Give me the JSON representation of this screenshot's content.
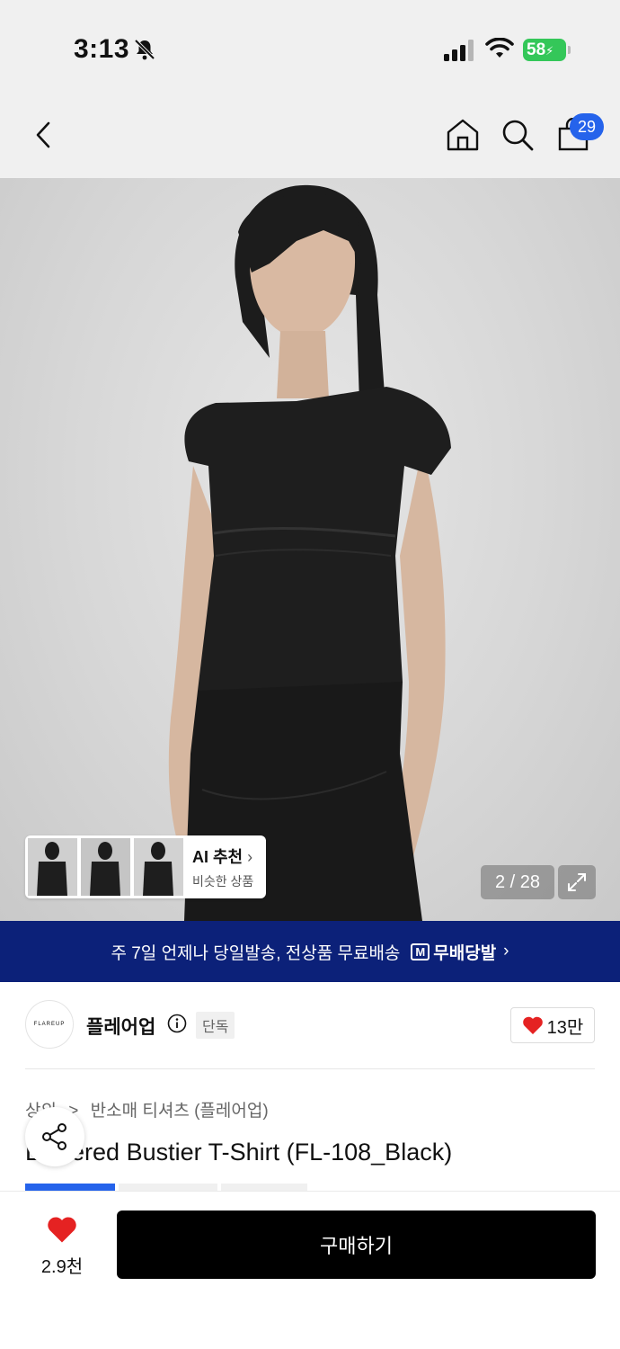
{
  "status": {
    "time": "3:13",
    "battery": "58"
  },
  "nav": {
    "cart_count": "29"
  },
  "hero": {
    "ai_title": "AI 추천",
    "ai_subtitle": "비슷한 상품",
    "counter": "2 / 28"
  },
  "promo": {
    "text": "주 7일 언제나 당일발송, 전상품 무료배송",
    "badge": "무배당발",
    "badge_icon": "M"
  },
  "brand": {
    "logo_text": "FLAREUP",
    "name": "플레어업",
    "exclusive": "단독",
    "likes": "13만"
  },
  "product": {
    "breadcrumb_prefix": "상의",
    "breadcrumb": "반소매 티셔츠 (플레어업)",
    "title_visible": "L",
    "title_rest": "ered Bustier T-Shirt (FL-108_Black)"
  },
  "bottom": {
    "wish_count": "2.9천",
    "buy_label": "구매하기"
  },
  "colors": {
    "accent": "#2563eb",
    "promo_bg": "#0c2179",
    "heart": "#e52222"
  }
}
